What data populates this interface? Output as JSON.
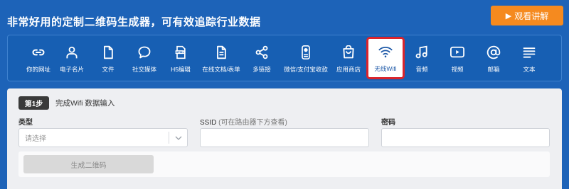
{
  "header": {
    "title": "非常好用的定制二维码生成器，可有效追踪行业数据",
    "watch_button": "观看讲解",
    "watch_icon": "play-triangle-icon"
  },
  "tools": [
    {
      "label": "你的网址",
      "icon": "link-icon"
    },
    {
      "label": "电子名片",
      "icon": "person-icon"
    },
    {
      "label": "文件",
      "icon": "file-icon"
    },
    {
      "label": "社交媒体",
      "icon": "speech-bubble-icon"
    },
    {
      "label": "H5编辑",
      "icon": "html-file-icon"
    },
    {
      "label": "在线文档/表单",
      "icon": "document-icon"
    },
    {
      "label": "多链接",
      "icon": "share-icon"
    },
    {
      "label": "微信/支付宝收款",
      "icon": "payment-icon"
    },
    {
      "label": "应用商店",
      "icon": "shopping-bag-icon"
    },
    {
      "label": "无线Wifi",
      "icon": "wifi-icon",
      "active": true
    },
    {
      "label": "音频",
      "icon": "music-note-icon"
    },
    {
      "label": "视频",
      "icon": "video-play-icon"
    },
    {
      "label": "邮箱",
      "icon": "at-sign-icon"
    },
    {
      "label": "文本",
      "icon": "text-lines-icon"
    }
  ],
  "form": {
    "step_badge": "第1步",
    "step_text": "完成Wifi 数据输入",
    "type_label": "类型",
    "type_placeholder": "请选择",
    "ssid_label": "SSID",
    "ssid_hint": "(可在路由器下方查看)",
    "password_label": "密码",
    "generate_button": "生成二维码"
  },
  "colors": {
    "background": "#1d63b8",
    "accent_orange": "#f58a1f",
    "active_border": "#d9242c"
  }
}
